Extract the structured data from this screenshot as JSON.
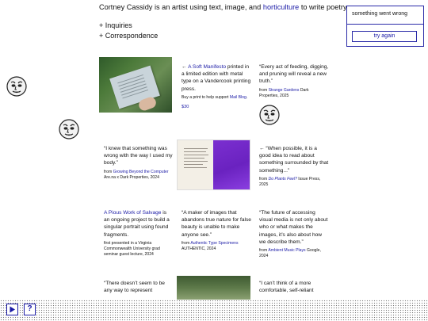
{
  "intro": {
    "prefix": "Cortney Cassidy is an artist using text, image, and ",
    "link": "horticulture",
    "suffix": " to write poetry."
  },
  "nav": [
    {
      "label": "+ Inquiries"
    },
    {
      "label": "+ Correspondence"
    }
  ],
  "error_box": {
    "message": "something went wrong",
    "button": "try again"
  },
  "grid": {
    "manifesto": {
      "arrow": "←",
      "title": "A Soft Manifesto",
      "body": "printed in a limited edition with metal type on a Vandercook printing press.",
      "buy_prefix": "Buy a print to help support ",
      "buy_link": "Mail Blog",
      "buy_suffix": ".",
      "price": "$30"
    },
    "quote_feeding": {
      "text": "“Every act of feeding, digging, and pruning will reveal a new truth.”",
      "source_prefix": "from ",
      "source_link": "Strange Gardens",
      "source_suffix": " Dark Properties, 2025"
    },
    "quote_wrong": {
      "text": "“I knew that something was wrong with the way I used my body.”",
      "source_prefix": "from ",
      "source_link": "Growing Beyond the Computer",
      "source_suffix": " Are.na x Dark Properties, 2024"
    },
    "quote_possible": {
      "text": "← “When possible, it is a good idea to read about something surrounded by that something...”",
      "source_prefix": "from ",
      "source_link": "Do Plants Feel?",
      "source_suffix": " Issue Press, 2025"
    },
    "salvage": {
      "title": "A Pious Work of Salvage",
      "body": "is an ongoing project to build a singular portrait using found fragments.",
      "note": "first presented in a Virginia Commonwealth University grad seminar guest lecture, 2024"
    },
    "quote_maker": {
      "text": "“A maker of images that abandons true nature for false beauty is unable to make anyone see.”",
      "source_prefix": "from ",
      "source_link": "Authentic Type Specimens",
      "source_suffix": " AUTHENTIC, 2024"
    },
    "quote_future": {
      "text": "“The future of accessing visual media is not only about who or what makes the images, it’s also about how we describe them.”",
      "source_prefix": "from ",
      "source_link": "Ambient Music Plays",
      "source_suffix": " Google, 2024"
    },
    "quote_represent": {
      "text": "“There doesn’t seem to be any way to represent"
    },
    "quote_comfortable": {
      "text": "“I can’t think of a more comfortable, self-reliant"
    }
  },
  "controls": {
    "play_icon": "play-icon",
    "help_label": "?"
  },
  "colors": {
    "link": "#1a1aa6",
    "accent_purple": "#7b2fd0"
  }
}
